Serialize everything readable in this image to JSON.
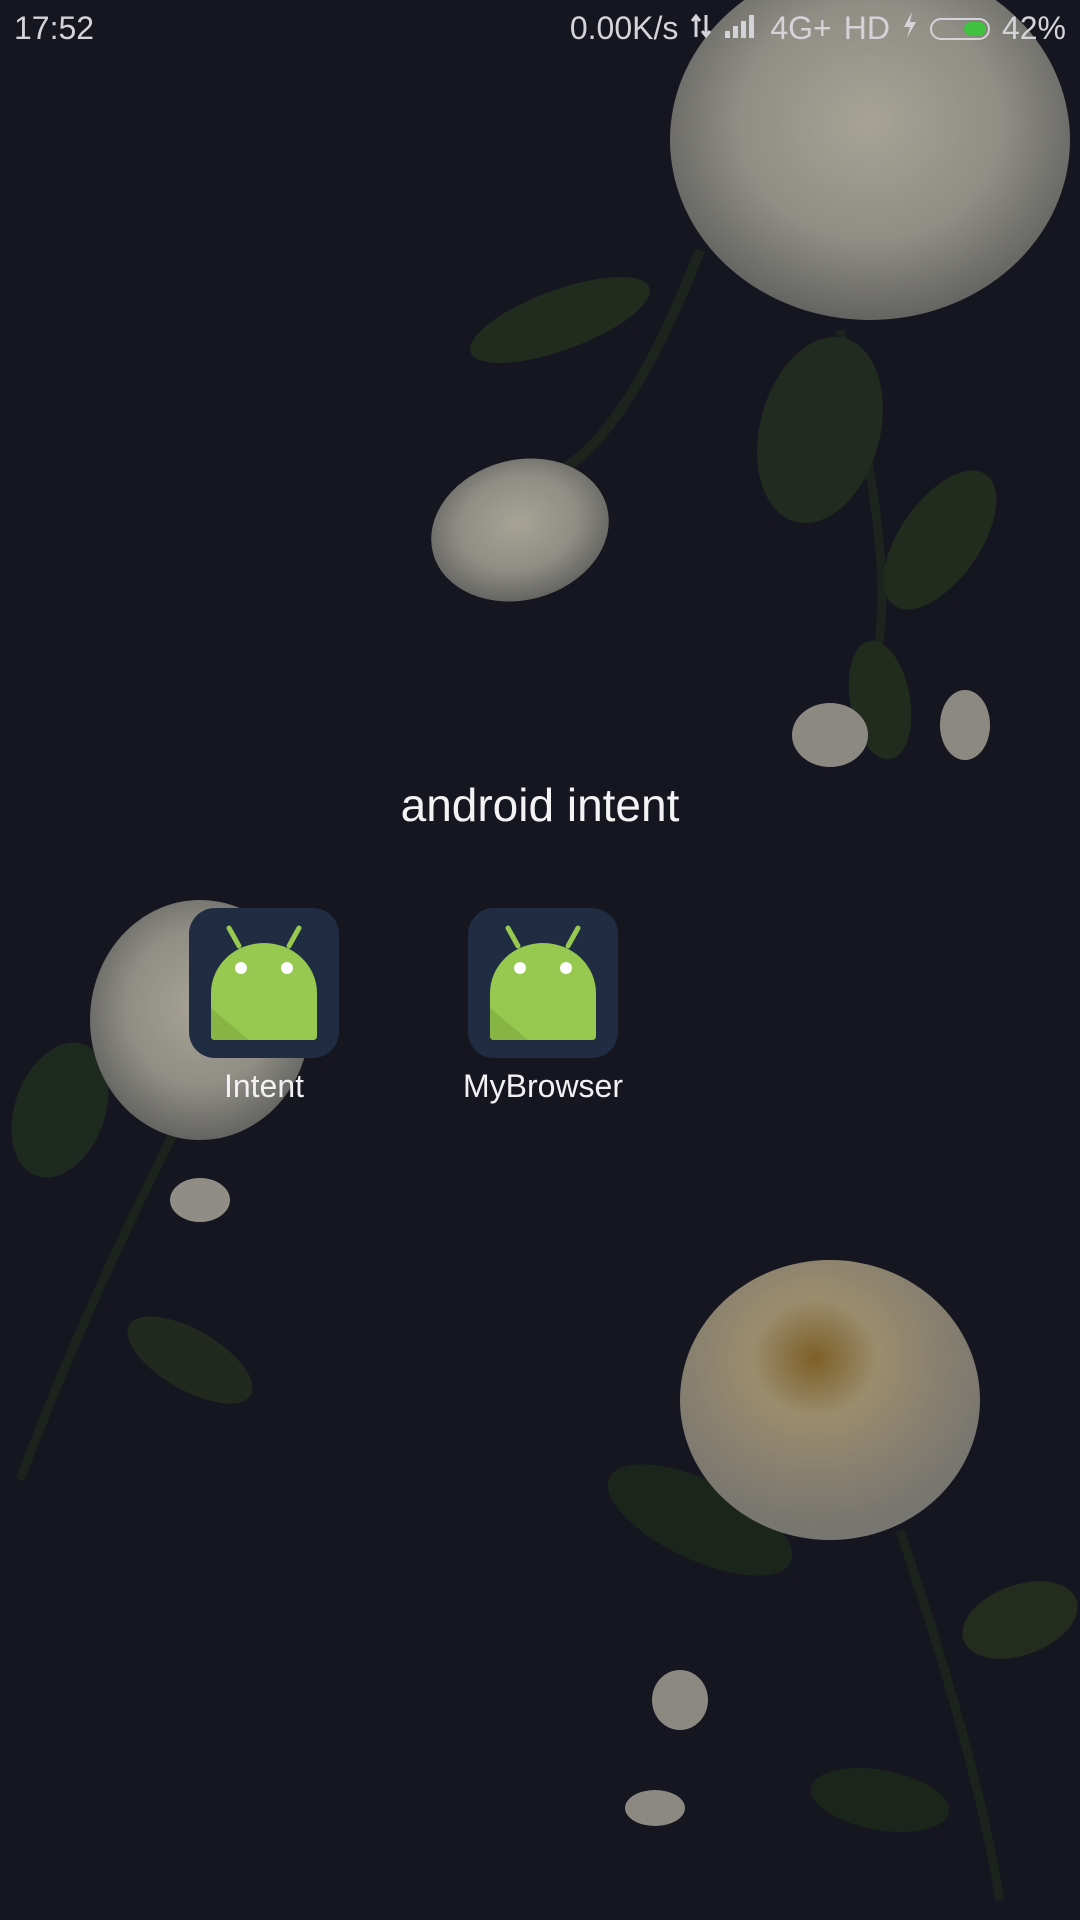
{
  "status_bar": {
    "time": "17:52",
    "net_speed": "0.00K/s",
    "network": "4G+",
    "hd": "HD",
    "battery_text": "42%",
    "battery_level": 0.42
  },
  "folder": {
    "title": "android intent",
    "apps": [
      {
        "label": "Intent",
        "icon": "android-robot-icon"
      },
      {
        "label": "MyBrowser",
        "icon": "android-robot-icon"
      }
    ]
  },
  "colors": {
    "background": "#15161f",
    "icon_bg": "#1f2c42",
    "android_green": "#97c84f",
    "battery_green": "#3fc23f"
  }
}
